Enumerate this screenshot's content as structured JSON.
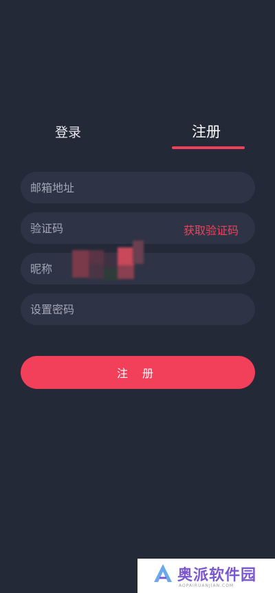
{
  "tabs": {
    "login": "登录",
    "register": "注册",
    "active": "register"
  },
  "form": {
    "email_placeholder": "邮箱地址",
    "code_placeholder": "验证码",
    "get_code": "获取验证码",
    "nickname_placeholder": "昵称",
    "password_placeholder": "设置密码"
  },
  "submit_label": "注 册",
  "watermark": {
    "text": "奥派软件园",
    "sub": "AOPAIRUANJIAN.COM"
  },
  "colors": {
    "background": "#242938",
    "field": "#2e3445",
    "accent": "#f2405b"
  }
}
